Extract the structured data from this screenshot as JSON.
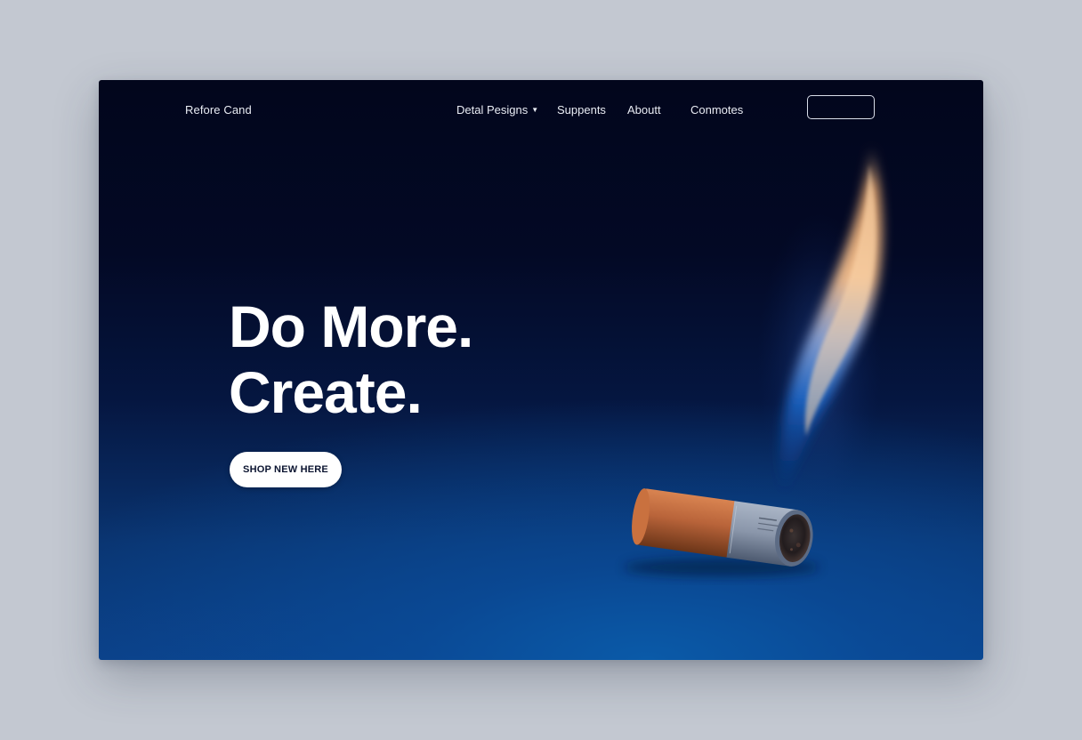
{
  "nav": {
    "brand": "Refore Cand",
    "links": [
      {
        "label": "Detal Pesigns",
        "has_dropdown": true
      },
      {
        "label": "Suppents"
      },
      {
        "label": "Aboutt"
      },
      {
        "label": "Conmotes"
      }
    ],
    "cta_label": ""
  },
  "hero": {
    "title_line1": "Do More.",
    "title_line2": "Create.",
    "button_label": "SHOP NEW HERE"
  },
  "icons": {
    "dropdown": "chevron-down-icon",
    "flame": "flame-illustration",
    "cigarette": "cigarette-butt-illustration"
  },
  "colors": {
    "page_background": "#c3c8d1",
    "hero_dark": "#02061c",
    "hero_blue": "#0b3f86",
    "text_light": "#e9ecf4",
    "button_bg": "#ffffff",
    "button_text": "#0b1430",
    "filter_orange": "#b9643a",
    "flame_orange": "#f7b57a",
    "flame_blue": "#1e6cd0"
  }
}
